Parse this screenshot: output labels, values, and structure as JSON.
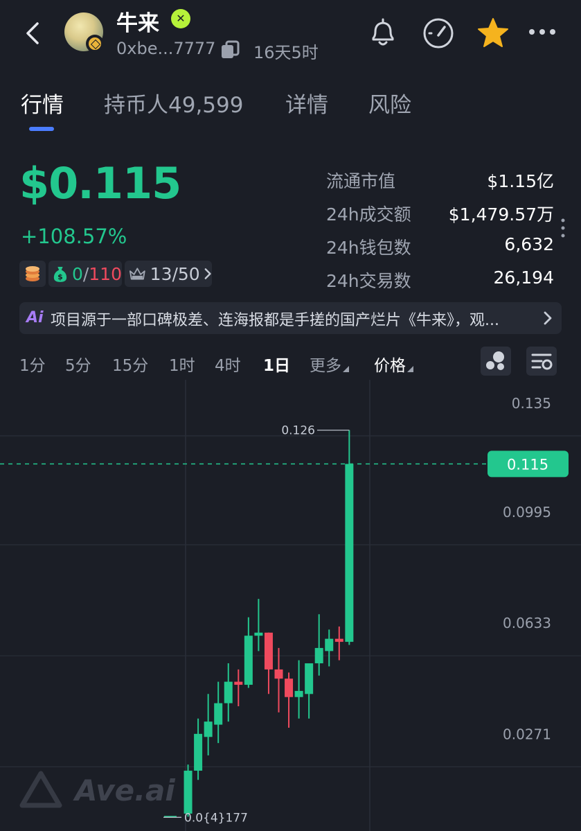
{
  "header": {
    "token_name": "牛来",
    "address": "0xbe...7777",
    "age": "16天5时",
    "icons": [
      "back-icon",
      "avatar",
      "bnb-chain-badge",
      "verified-icon",
      "copy-icon",
      "bell-icon",
      "gauge-icon",
      "star-icon",
      "more-icon"
    ],
    "star_color": "#f5b31e"
  },
  "tabs": [
    {
      "label": "行情",
      "active": true
    },
    {
      "label": "持币人49,599",
      "active": false
    },
    {
      "label": "详情",
      "active": false
    },
    {
      "label": "风险",
      "active": false
    }
  ],
  "price": {
    "value": "$0.115",
    "change": "+108.57%",
    "color": "#23c78e"
  },
  "badges": {
    "coins_icon": "coins-icon",
    "money_icon": "money-bag-icon",
    "money_a": "0",
    "money_sep": "/",
    "money_b": "110",
    "top_icon": "top-crown-icon",
    "top_text": "13/50"
  },
  "stats": [
    {
      "label": "流通市值",
      "value": "$1.15亿"
    },
    {
      "label": "24h成交额",
      "value": "$1,479.57万"
    },
    {
      "label": "24h钱包数",
      "value": "6,632"
    },
    {
      "label": "24h交易数",
      "value": "26,194"
    }
  ],
  "ai_banner": {
    "icon": "Ai",
    "text": "项目源于一部口碑极差、连海报都是手搓的国产烂片《牛来》，观..."
  },
  "timeframes": [
    {
      "label": "1分",
      "active": false
    },
    {
      "label": "5分",
      "active": false
    },
    {
      "label": "15分",
      "active": false
    },
    {
      "label": "1时",
      "active": false
    },
    {
      "label": "4时",
      "active": false
    },
    {
      "label": "1日",
      "active": true
    },
    {
      "label": "更多",
      "active": false,
      "dropdown": true
    },
    {
      "label": "价格",
      "active": false,
      "dropdown": true,
      "bright": true
    }
  ],
  "chart_data": {
    "type": "candlestick",
    "y_ticks": [
      "0.135",
      "0.0995",
      "0.0633",
      "0.0271"
    ],
    "y_tick_values": [
      0.135,
      0.0995,
      0.0633,
      0.0271
    ],
    "current_price": 0.115,
    "current_price_label": "0.115",
    "high_marker_label": "0.126",
    "high_marker_value": 0.126,
    "low_marker_label": "0.0{4}177",
    "low_marker_value": 1.77e-05,
    "up_color": "#23c78e",
    "down_color": "#ef4a5e",
    "grid": true,
    "candles": [
      {
        "o": 1.77e-05,
        "h": 1.77e-05,
        "l": 1.77e-05,
        "c": 1.77e-05
      },
      {
        "o": 0.001,
        "h": 0.017,
        "l": 0.0,
        "c": 0.015
      },
      {
        "o": 0.015,
        "h": 0.032,
        "l": 0.012,
        "c": 0.027
      },
      {
        "o": 0.026,
        "h": 0.04,
        "l": 0.02,
        "c": 0.031
      },
      {
        "o": 0.03,
        "h": 0.044,
        "l": 0.024,
        "c": 0.037
      },
      {
        "o": 0.037,
        "h": 0.05,
        "l": 0.031,
        "c": 0.044
      },
      {
        "o": 0.044,
        "h": 0.048,
        "l": 0.036,
        "c": 0.043
      },
      {
        "o": 0.043,
        "h": 0.065,
        "l": 0.042,
        "c": 0.059
      },
      {
        "o": 0.059,
        "h": 0.071,
        "l": 0.054,
        "c": 0.06
      },
      {
        "o": 0.06,
        "h": 0.06,
        "l": 0.04,
        "c": 0.048
      },
      {
        "o": 0.048,
        "h": 0.055,
        "l": 0.034,
        "c": 0.045
      },
      {
        "o": 0.045,
        "h": 0.047,
        "l": 0.029,
        "c": 0.039
      },
      {
        "o": 0.039,
        "h": 0.051,
        "l": 0.032,
        "c": 0.041
      },
      {
        "o": 0.04,
        "h": 0.047,
        "l": 0.032,
        "c": 0.05
      },
      {
        "o": 0.05,
        "h": 0.066,
        "l": 0.046,
        "c": 0.055
      },
      {
        "o": 0.054,
        "h": 0.061,
        "l": 0.049,
        "c": 0.058
      },
      {
        "o": 0.058,
        "h": 0.062,
        "l": 0.051,
        "c": 0.057
      },
      {
        "o": 0.057,
        "h": 0.126,
        "l": 0.056,
        "c": 0.115
      }
    ]
  },
  "watermark": "Ave.ai"
}
